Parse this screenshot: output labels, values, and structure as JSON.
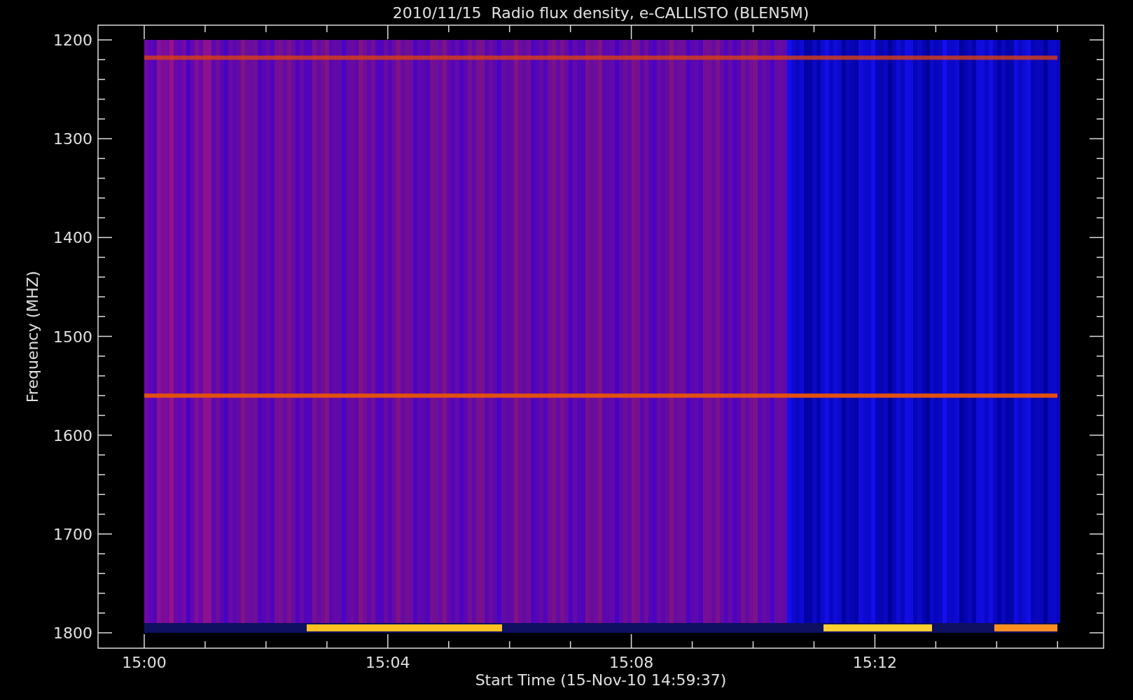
{
  "title": "2010/11/15  Radio flux density, e-CALLISTO (BLEN5M)",
  "y_axis": {
    "label": "Frequency (MHZ)",
    "ticks": [
      "1200",
      "1300",
      "1400",
      "1500",
      "1600",
      "1700",
      "1800"
    ]
  },
  "x_axis": {
    "label": "Start Time (15-Nov-10 14:59:37)",
    "ticks": [
      "15:00",
      "15:04",
      "15:08",
      "15:12"
    ]
  }
}
